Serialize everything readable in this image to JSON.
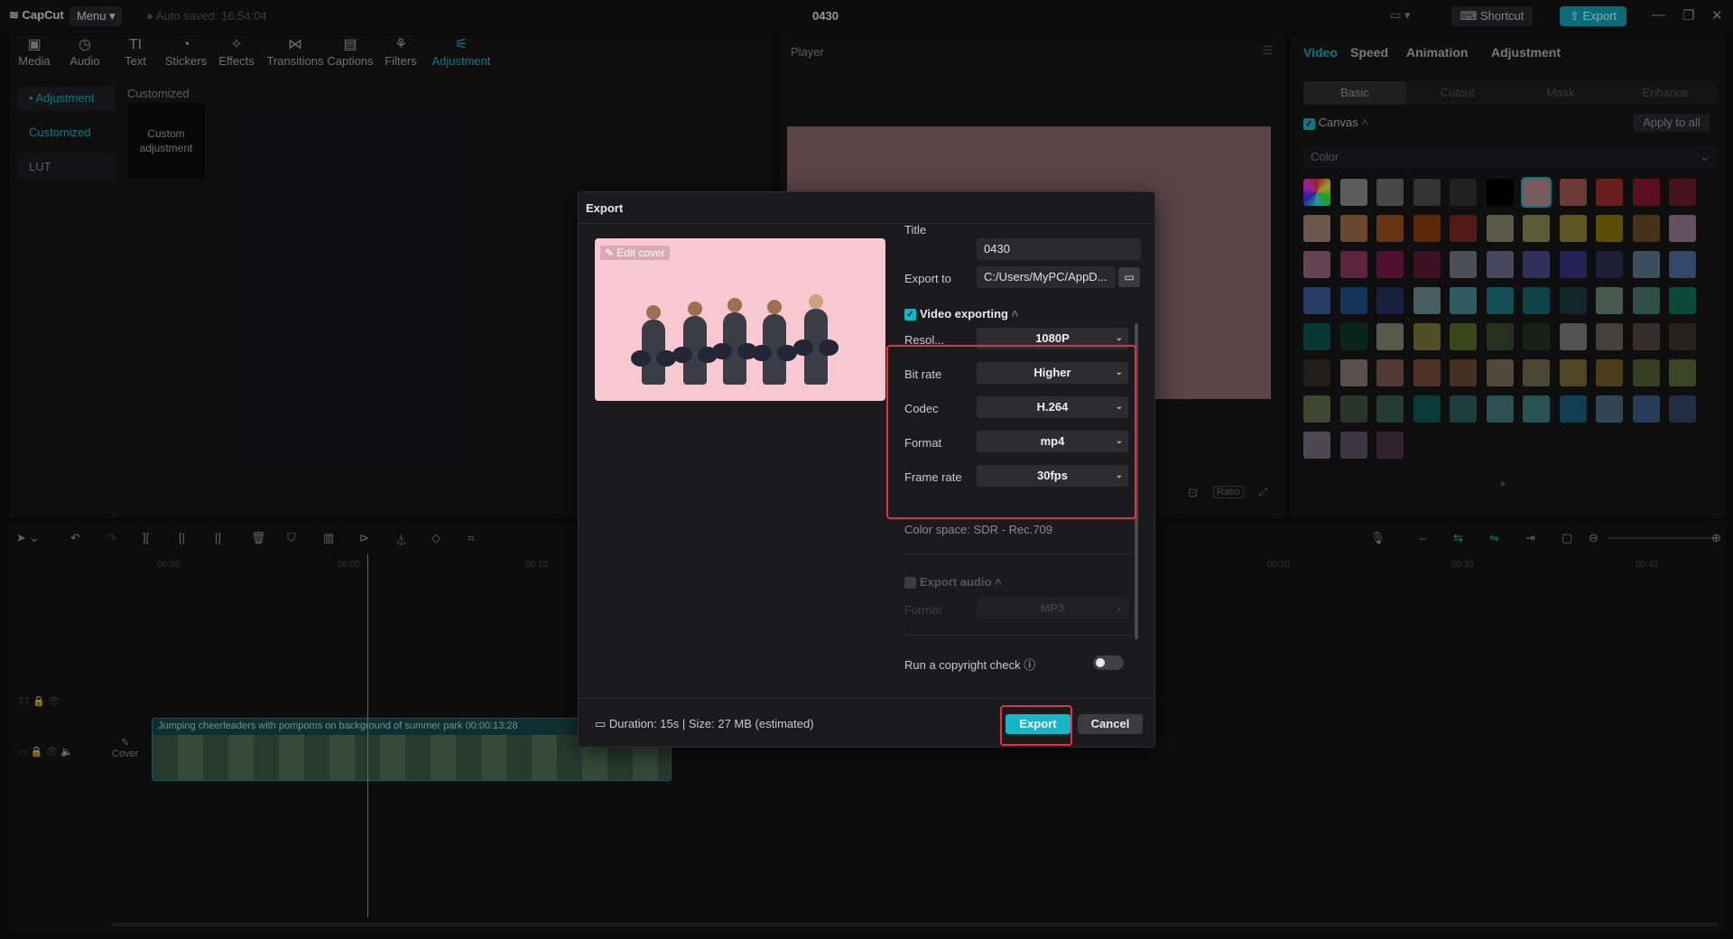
{
  "titlebar": {
    "app_name": "CapCut",
    "menu_label": "Menu",
    "autosave": "Auto saved: 16:54:04",
    "project_title": "0430",
    "shortcut_label": "Shortcut",
    "export_label": "Export"
  },
  "toolbar": {
    "items": [
      {
        "label": "Media",
        "icon": "media-icon"
      },
      {
        "label": "Audio",
        "icon": "audio-icon"
      },
      {
        "label": "Text",
        "icon": "text-icon"
      },
      {
        "label": "Stickers",
        "icon": "stickers-icon"
      },
      {
        "label": "Effects",
        "icon": "effects-icon"
      },
      {
        "label": "Transitions",
        "icon": "transitions-icon"
      },
      {
        "label": "Captions",
        "icon": "captions-icon"
      },
      {
        "label": "Filters",
        "icon": "filters-icon"
      },
      {
        "label": "Adjustment",
        "icon": "adjustment-icon"
      }
    ]
  },
  "sidenav": {
    "items": [
      "• Adjustment",
      "Customized",
      "LUT"
    ]
  },
  "media": {
    "section_title": "Customized",
    "card_label": "Custom adjustment"
  },
  "player": {
    "title": "Player",
    "ratio_label": "Ratio"
  },
  "inspector": {
    "tabs": [
      "Video",
      "Speed",
      "Animation",
      "Adjustment"
    ],
    "subtabs": [
      "Basic",
      "Cutout",
      "Mask",
      "Enhance"
    ],
    "canvas_label": "Canvas",
    "apply_all": "Apply to all",
    "color_select": "Color"
  },
  "timeline": {
    "ruler": [
      "00:00",
      "00:05",
      "00:10",
      "00:30",
      "00:35",
      "00:40"
    ],
    "clip_title": "Jumping cheerleaders with pompoms on background of summer park",
    "clip_duration": "00:00:13:28",
    "cover_label": "Cover"
  },
  "export_dialog": {
    "title": "Export",
    "edit_cover": "Edit cover",
    "title_label": "Title",
    "title_value": "0430",
    "export_to_label": "Export to",
    "export_to_value": "C:/Users/MyPC/AppD...",
    "video_exporting": "Video exporting",
    "settings": [
      {
        "label": "Resol...",
        "value": "1080P"
      },
      {
        "label": "Bit rate",
        "value": "Higher"
      },
      {
        "label": "Codec",
        "value": "H.264"
      },
      {
        "label": "Format",
        "value": "mp4"
      },
      {
        "label": "Frame rate",
        "value": "30fps"
      }
    ],
    "color_space": "Color space: SDR - Rec.709",
    "export_audio": "Export audio",
    "audio_format_label": "Format",
    "audio_format_value": "MP3",
    "copyright_check": "Run a copyright check",
    "duration_size": "Duration: 15s | Size: 27 MB (estimated)",
    "export_button": "Export",
    "cancel_button": "Cancel"
  },
  "colors": {
    "accent": "#18b5c6",
    "highlight": "#e3333e"
  }
}
